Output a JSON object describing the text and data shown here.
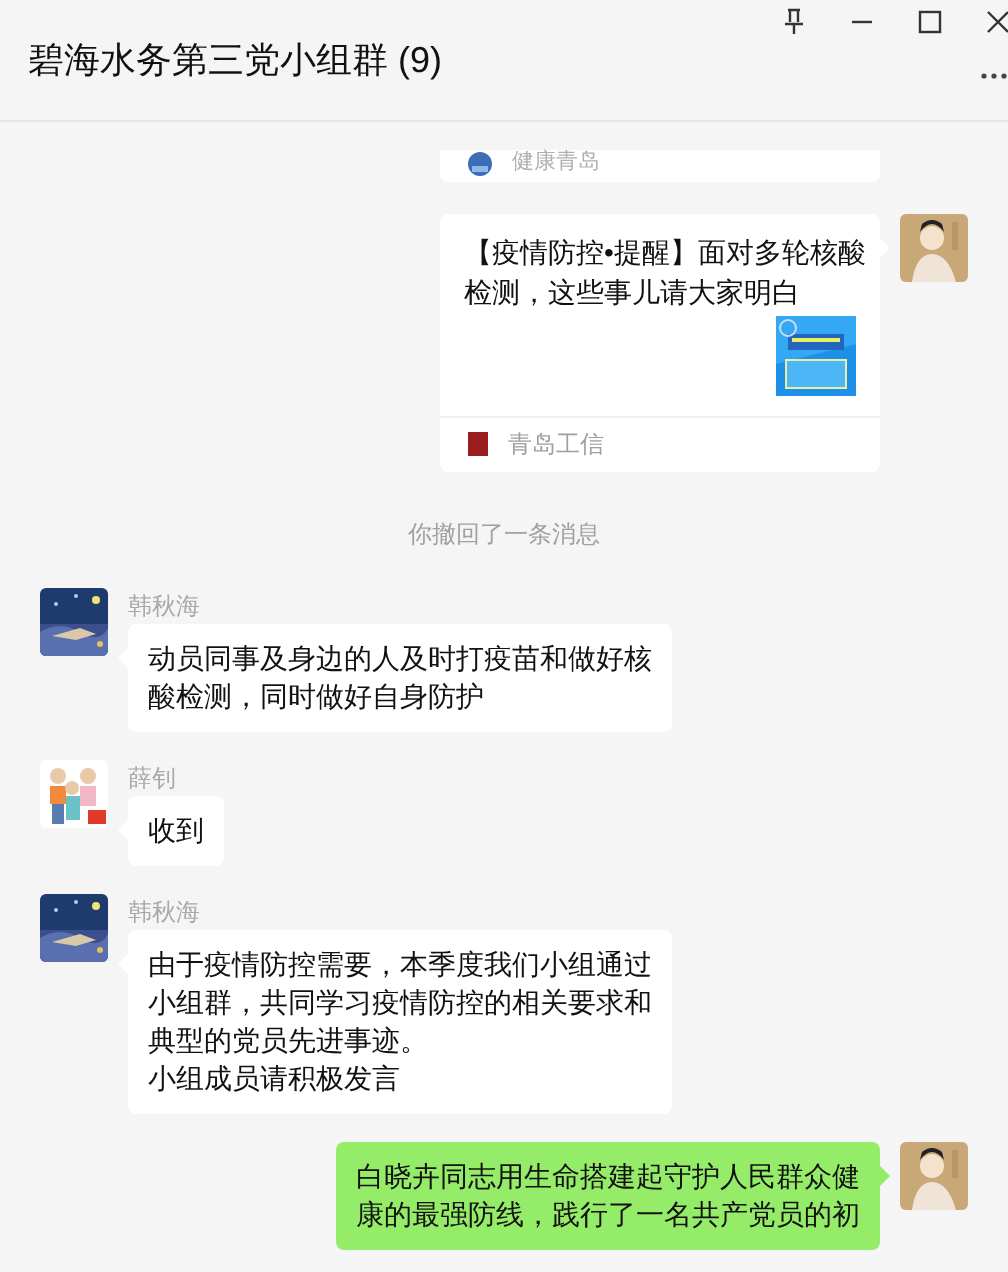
{
  "window": {
    "title": "碧海水务第三党小组群 (9)"
  },
  "messages": [
    {
      "kind": "article_tail",
      "source": "健康青岛",
      "source_logo": {
        "kind": "round"
      }
    },
    {
      "kind": "article",
      "avatar": {
        "kind": "portrait"
      },
      "title": "【疫情防控•提醒】面对多轮核酸检测，这些事儿请大家明白",
      "source": "青岛工信",
      "source_logo": {
        "kind": "square"
      }
    },
    {
      "kind": "notice",
      "text": "你撤回了一条消息"
    },
    {
      "kind": "text",
      "outgoing": false,
      "avatar": {
        "kind": "night"
      },
      "sender": "韩秋海",
      "lines": [
        "动员同事及身边的人及时打疫苗和做好核酸检测，同时做好自身防护"
      ]
    },
    {
      "kind": "text",
      "outgoing": false,
      "avatar": {
        "kind": "family"
      },
      "sender": "薛钊",
      "lines": [
        "收到"
      ]
    },
    {
      "kind": "text",
      "outgoing": false,
      "avatar": {
        "kind": "night"
      },
      "sender": "韩秋海",
      "lines": [
        "由于疫情防控需要，本季度我们小组通过小组群，共同学习疫情防控的相关要求和典型的党员先进事迹。",
        "小组成员请积极发言"
      ]
    },
    {
      "kind": "text",
      "outgoing": true,
      "avatar": {
        "kind": "portrait"
      },
      "lines": [
        "白晓卉同志用生命搭建起守护人民群众健康的最强防线，践行了一名共产党员的初"
      ]
    }
  ]
}
